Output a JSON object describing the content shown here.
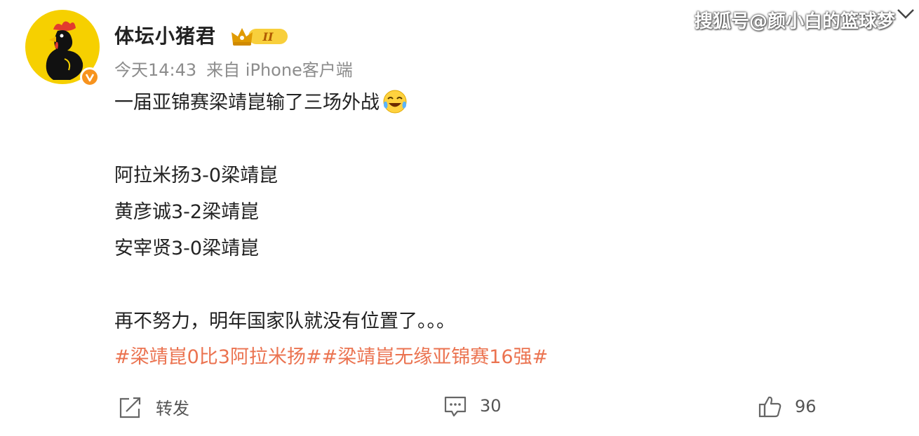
{
  "watermark": {
    "text": "搜狐号@颜小白的篮球梦"
  },
  "post": {
    "author": "体坛小猪君",
    "level_badge": "II",
    "timestamp": "今天14:43",
    "source": "来自 iPhone客户端",
    "lines": {
      "headline": "一届亚锦赛梁靖崑输了三场外战",
      "result_1": "阿拉米扬3-0梁靖崑",
      "result_2": "黄彦诚3-2梁靖崑",
      "result_3": "安宰贤3-0梁靖崑",
      "closing": "再不努力，明年国家队就没有位置了。。。"
    },
    "tags": "#梁靖崑0比3阿拉米扬##梁靖崑无缘亚锦赛16强#"
  },
  "actions": {
    "repost": {
      "label": "转发",
      "icon": "share-icon"
    },
    "comment": {
      "count": "30",
      "icon": "comment-icon"
    },
    "like": {
      "count": "96",
      "icon": "thumbs-up-icon"
    }
  },
  "colors": {
    "tag": "#eb7350",
    "meta": "#8c8c8c",
    "badge_orange": "#f7931e",
    "avatar_bg": "#f6d000"
  }
}
